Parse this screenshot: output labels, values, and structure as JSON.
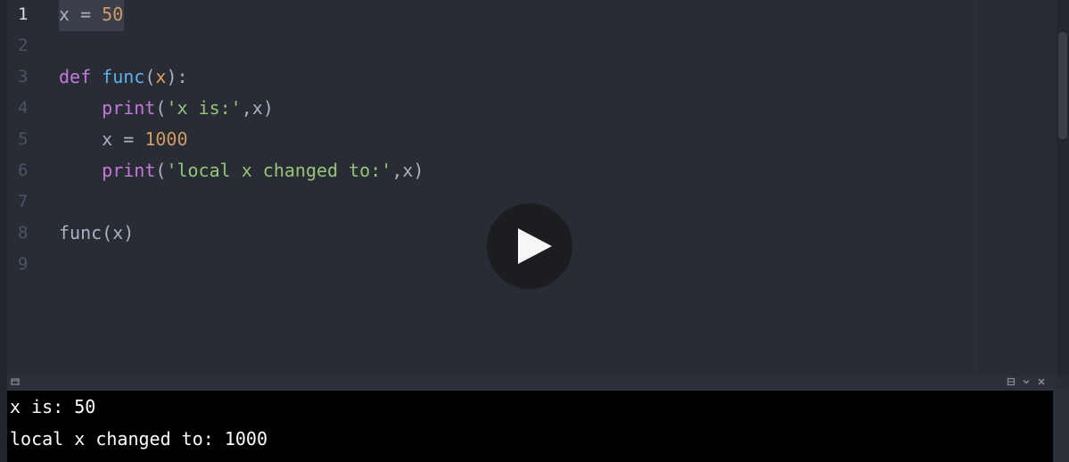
{
  "editor": {
    "line_numbers": [
      "1",
      "2",
      "3",
      "4",
      "5",
      "6",
      "7",
      "8",
      "9"
    ],
    "lines": {
      "l1": {
        "var": "x",
        "op": " = ",
        "value": "50"
      },
      "l3": {
        "kw": "def",
        "fn": "func",
        "open": "(",
        "param": "x",
        "close": "):"
      },
      "l4": {
        "indent": "    ",
        "fn": "print",
        "open": "(",
        "str": "'x is:'",
        "rest": ",x)"
      },
      "l5": {
        "indent": "    ",
        "var": "x",
        "op": " = ",
        "value": "1000"
      },
      "l6": {
        "indent": "    ",
        "fn": "print",
        "open": "(",
        "str": "'local x changed to:'",
        "rest": ",x)"
      },
      "l8": {
        "text": "func(x)"
      }
    }
  },
  "console": {
    "output": [
      "x is: 50",
      "local x changed to: 1000"
    ]
  },
  "icons": {
    "play": "play-icon",
    "panel": "panel-icon",
    "maximize": "maximize-icon",
    "collapse": "chevron-down-icon",
    "close": "close-icon"
  },
  "colors": {
    "editor_bg": "#282c34",
    "keyword": "#c678dd",
    "function": "#61afef",
    "number": "#d19a66",
    "string": "#98c379",
    "console_bg": "#000000"
  }
}
